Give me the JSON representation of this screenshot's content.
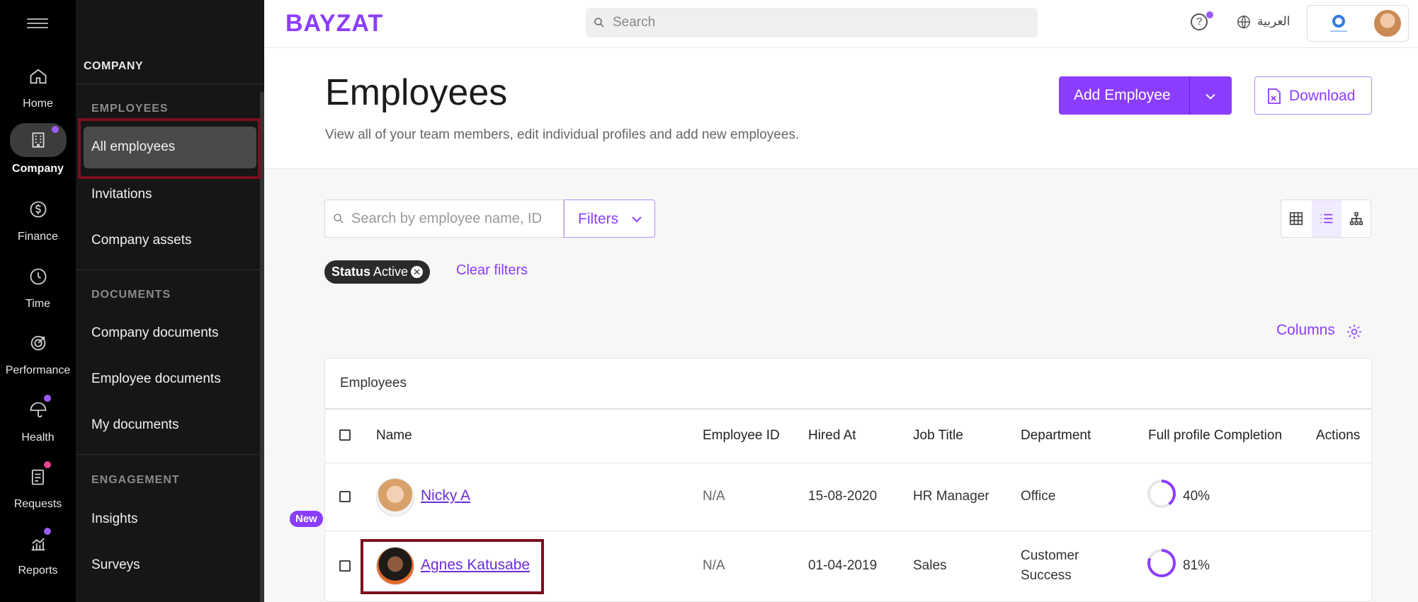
{
  "rail": {
    "items": [
      {
        "label": "Home",
        "icon": "home-icon"
      },
      {
        "label": "Company",
        "icon": "building-icon"
      },
      {
        "label": "Finance",
        "icon": "dollar-icon"
      },
      {
        "label": "Time",
        "icon": "clock-icon"
      },
      {
        "label": "Performance",
        "icon": "target-icon"
      },
      {
        "label": "Health",
        "icon": "umbrella-icon"
      },
      {
        "label": "Requests",
        "icon": "clipboard-icon"
      },
      {
        "label": "Reports",
        "icon": "chart-icon"
      }
    ],
    "active": "Company"
  },
  "submenu": {
    "title": "COMPANY",
    "sections": {
      "employees": "EMPLOYEES",
      "documents": "DOCUMENTS",
      "engagement": "ENGAGEMENT"
    },
    "items": {
      "all_employees": "All employees",
      "invitations": "Invitations",
      "company_assets": "Company assets",
      "company_documents": "Company documents",
      "employee_documents": "Employee documents",
      "my_documents": "My documents",
      "insights": "Insights",
      "insights_badge": "New",
      "surveys": "Surveys"
    }
  },
  "topbar": {
    "logo": "BAYZAT",
    "search_placeholder": "Search",
    "help": "?",
    "language": "العربية"
  },
  "header": {
    "title": "Employees",
    "subtitle": "View all of your team members, edit individual profiles and add new employees.",
    "add_employee": "Add Employee",
    "download": "Download"
  },
  "filters": {
    "search_placeholder": "Search by employee name, ID",
    "filters_label": "Filters",
    "chip_key": "Status",
    "chip_value": "Active",
    "clear": "Clear filters",
    "columns": "Columns"
  },
  "table": {
    "caption": "Employees",
    "headers": [
      "Name",
      "Employee ID",
      "Hired At",
      "Job Title",
      "Department",
      "Full profile Completion",
      "Actions"
    ],
    "rows": [
      {
        "name": "Nicky A",
        "employee_id": "N/A",
        "hired_at": "15-08-2020",
        "job_title": "HR Manager",
        "department": "Office",
        "department_2": "",
        "completion": "40%",
        "completion_value": 0.4
      },
      {
        "name": "Agnes Katusabe",
        "employee_id": "N/A",
        "hired_at": "01-04-2019",
        "job_title": "Sales",
        "department": "Customer",
        "department_2": "Success",
        "completion": "81%",
        "completion_value": 0.81
      }
    ]
  },
  "colors": {
    "accent": "#8b3dff",
    "highlight": "#7a0f1f"
  }
}
